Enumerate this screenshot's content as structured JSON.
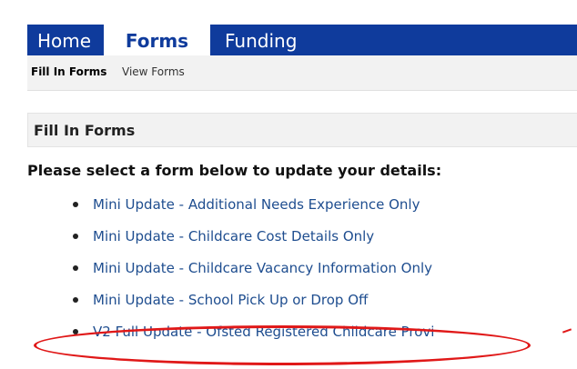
{
  "topnav": {
    "tabs": [
      {
        "label": "Home"
      },
      {
        "label": "Forms"
      },
      {
        "label": "Funding"
      }
    ]
  },
  "subnav": {
    "active_label": "Fill In Forms",
    "other_label": "View Forms"
  },
  "section": {
    "title": "Fill In Forms"
  },
  "prompt": "Please select a form below to update your details:",
  "forms": [
    {
      "label": "Mini Update - Additional Needs Experience Only"
    },
    {
      "label": "Mini Update - Childcare Cost Details Only"
    },
    {
      "label": "Mini Update - Childcare Vacancy Information Only"
    },
    {
      "label": "Mini Update - School Pick Up or Drop Off"
    },
    {
      "label": "V2 Full Update - Ofsted Registered Childcare Provi"
    }
  ],
  "colors": {
    "nav_background": "#0f3b9c",
    "link": "#1e4d8f",
    "annotation": "#e01818"
  }
}
